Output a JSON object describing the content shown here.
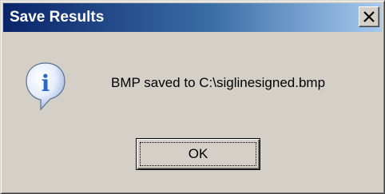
{
  "window": {
    "title": "Save Results",
    "close_icon": "close-x-icon"
  },
  "content": {
    "icon": "information-icon",
    "icon_glyph": "i",
    "message": "BMP saved to C:\\siglinesigned.bmp"
  },
  "buttons": {
    "ok_label": "OK"
  },
  "colors": {
    "dialog_face": "#d4d0c8",
    "titlebar_start": "#0a246a",
    "titlebar_end": "#a6caf0",
    "icon_blue": "#2a66c8"
  }
}
